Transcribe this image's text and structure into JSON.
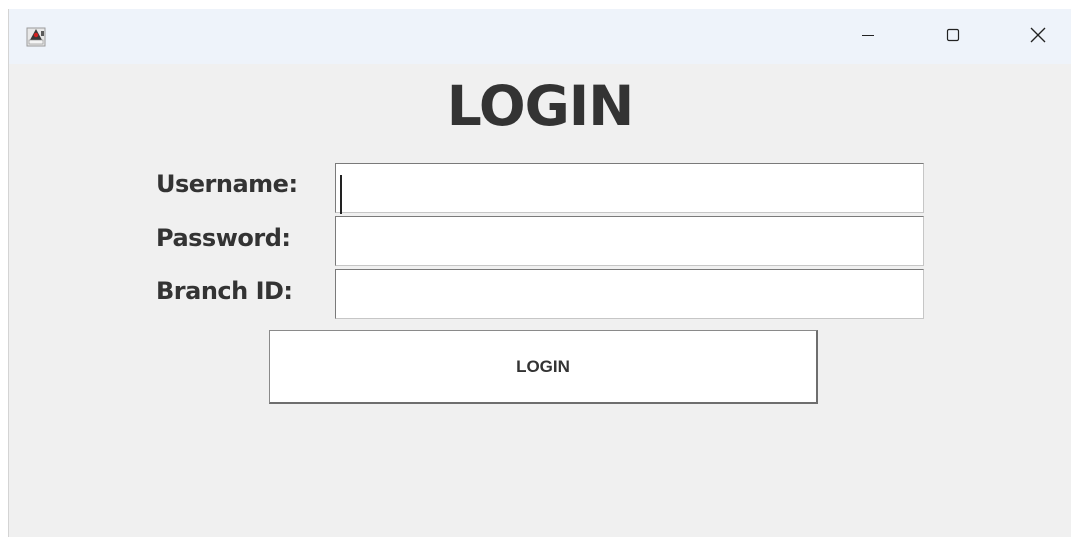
{
  "titlebar": {
    "icons": {
      "app": "java-duke-icon",
      "minimize": "minimize-icon",
      "maximize": "maximize-icon",
      "close": "close-icon"
    }
  },
  "form": {
    "title": "LOGIN",
    "username_label": "Username:",
    "username_value": "",
    "password_label": "Password:",
    "password_value": "",
    "branch_label": "Branch ID:",
    "branch_value": "",
    "submit_label": "LOGIN"
  },
  "colors": {
    "titlebar_bg": "#eef3fa",
    "window_bg": "#f0f0f0",
    "text": "#333333"
  }
}
